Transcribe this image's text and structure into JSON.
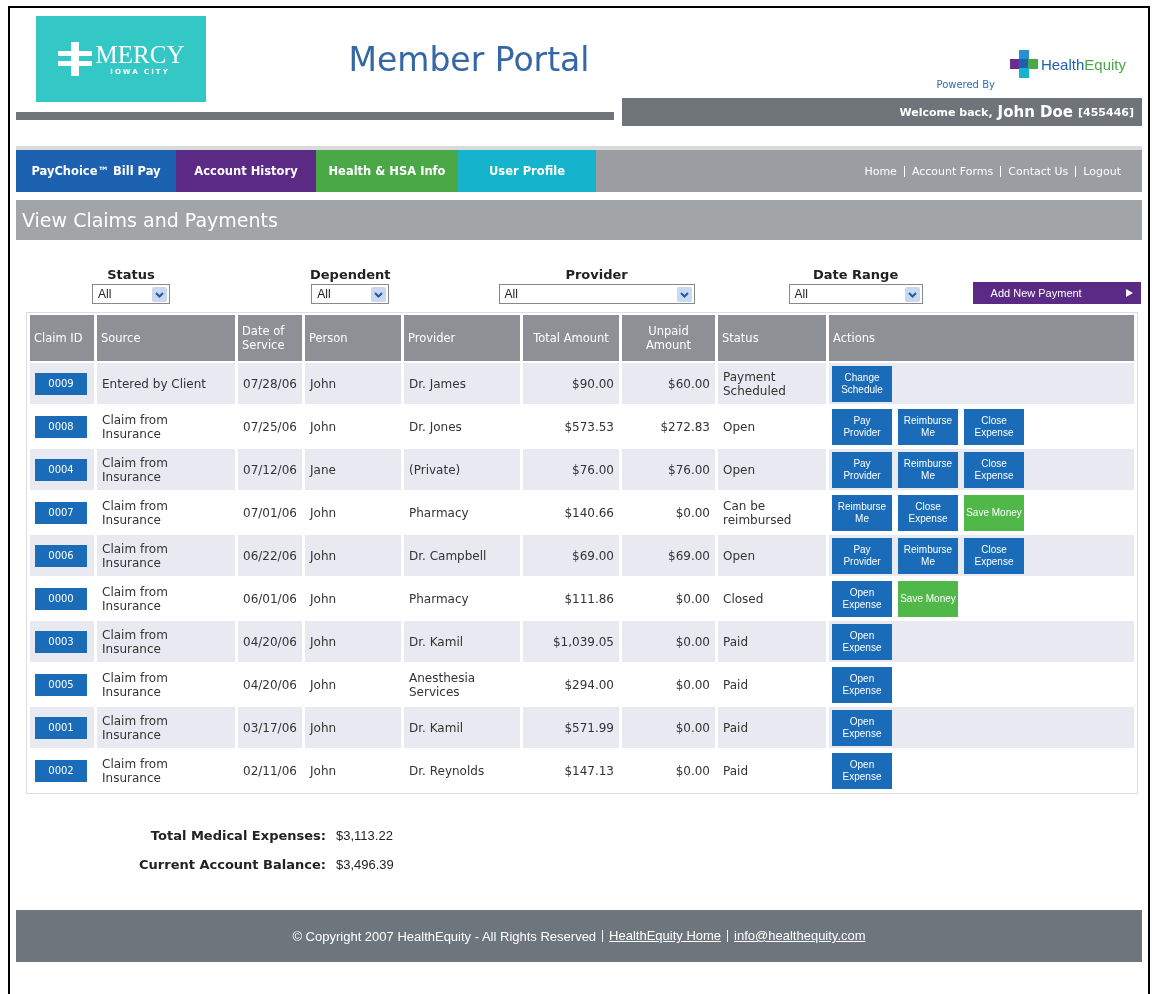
{
  "header": {
    "logo": {
      "name": "MERCY",
      "city": "IOWA CITY"
    },
    "title": "Member Portal",
    "powered_by": "Powered By",
    "partner": {
      "part_a": "Health",
      "part_b": "Equity"
    },
    "welcome": {
      "greeting": "Welcome back,",
      "user": "John Doe",
      "member_id": "[455446]"
    }
  },
  "nav": {
    "tabs": [
      {
        "label": "PayChoice™ Bill Pay",
        "color": "#1c62b0"
      },
      {
        "label": "Account History",
        "color": "#5a2a85"
      },
      {
        "label": "Health & HSA Info",
        "color": "#4aa847"
      },
      {
        "label": "User Profile",
        "color": "#16b4cc"
      }
    ],
    "links": [
      "Home",
      "Account Forms",
      "Contact Us",
      "Logout"
    ]
  },
  "section_title": "View Claims and Payments",
  "filters": [
    {
      "label": "Status",
      "value": "All"
    },
    {
      "label": "Dependent",
      "value": "All"
    },
    {
      "label": "Provider",
      "value": "All"
    },
    {
      "label": "Date Range",
      "value": "All"
    }
  ],
  "add_button": "Add New Payment",
  "table": {
    "columns": [
      "Claim ID",
      "Source",
      "Date of Service",
      "Person",
      "Provider",
      "Total Amount",
      "Unpaid Amount",
      "Status",
      "Actions"
    ],
    "rows": [
      {
        "claim_id": "0009",
        "source": "Entered by Client",
        "date": "07/28/06",
        "person": "John",
        "provider": "Dr. James",
        "total": "$90.00",
        "unpaid": "$60.00",
        "status": "Payment Scheduled",
        "actions": [
          {
            "label": "Change Schedule",
            "kind": "primary"
          }
        ]
      },
      {
        "claim_id": "0008",
        "source": "Claim from Insurance",
        "date": "07/25/06",
        "person": "John",
        "provider": "Dr. Jones",
        "total": "$573.53",
        "unpaid": "$272.83",
        "status": "Open",
        "actions": [
          {
            "label": "Pay Provider",
            "kind": "primary"
          },
          {
            "label": "Reimburse Me",
            "kind": "primary"
          },
          {
            "label": "Close Expense",
            "kind": "primary"
          }
        ]
      },
      {
        "claim_id": "0004",
        "source": "Claim from Insurance",
        "date": "07/12/06",
        "person": "Jane",
        "provider": "(Private)",
        "total": "$76.00",
        "unpaid": "$76.00",
        "status": "Open",
        "actions": [
          {
            "label": "Pay Provider",
            "kind": "primary"
          },
          {
            "label": "Reimburse Me",
            "kind": "primary"
          },
          {
            "label": "Close Expense",
            "kind": "primary"
          }
        ]
      },
      {
        "claim_id": "0007",
        "source": "Claim from Insurance",
        "date": "07/01/06",
        "person": "John",
        "provider": "Pharmacy",
        "total": "$140.66",
        "unpaid": "$0.00",
        "status": "Can be reimbursed",
        "actions": [
          {
            "label": "Reimburse Me",
            "kind": "primary"
          },
          {
            "label": "Close Expense",
            "kind": "primary"
          },
          {
            "label": "Save Money",
            "kind": "save"
          }
        ]
      },
      {
        "claim_id": "0006",
        "source": "Claim from Insurance",
        "date": "06/22/06",
        "person": "John",
        "provider": "Dr. Campbell",
        "total": "$69.00",
        "unpaid": "$69.00",
        "status": "Open",
        "actions": [
          {
            "label": "Pay Provider",
            "kind": "primary"
          },
          {
            "label": "Reimburse Me",
            "kind": "primary"
          },
          {
            "label": "Close Expense",
            "kind": "primary"
          }
        ]
      },
      {
        "claim_id": "0000",
        "source": "Claim from Insurance",
        "date": "06/01/06",
        "person": "John",
        "provider": "Pharmacy",
        "total": "$111.86",
        "unpaid": "$0.00",
        "status": "Closed",
        "actions": [
          {
            "label": "Open Expense",
            "kind": "primary"
          },
          {
            "label": "Save Money",
            "kind": "save"
          }
        ]
      },
      {
        "claim_id": "0003",
        "source": "Claim from Insurance",
        "date": "04/20/06",
        "person": "John",
        "provider": "Dr. Kamil",
        "total": "$1,039.05",
        "unpaid": "$0.00",
        "status": "Paid",
        "actions": [
          {
            "label": "Open Expense",
            "kind": "primary"
          }
        ]
      },
      {
        "claim_id": "0005",
        "source": "Claim from Insurance",
        "date": "04/20/06",
        "person": "John",
        "provider": "Anesthesia Services",
        "total": "$294.00",
        "unpaid": "$0.00",
        "status": "Paid",
        "actions": [
          {
            "label": "Open Expense",
            "kind": "primary"
          }
        ]
      },
      {
        "claim_id": "0001",
        "source": "Claim from Insurance",
        "date": "03/17/06",
        "person": "John",
        "provider": "Dr. Kamil",
        "total": "$571.99",
        "unpaid": "$0.00",
        "status": "Paid",
        "actions": [
          {
            "label": "Open Expense",
            "kind": "primary"
          }
        ]
      },
      {
        "claim_id": "0002",
        "source": "Claim from Insurance",
        "date": "02/11/06",
        "person": "John",
        "provider": "Dr. Reynolds",
        "total": "$147.13",
        "unpaid": "$0.00",
        "status": "Paid",
        "actions": [
          {
            "label": "Open Expense",
            "kind": "primary"
          }
        ]
      }
    ]
  },
  "totals": [
    {
      "label": "Total Medical Expenses:",
      "value": "$3,113.22"
    },
    {
      "label": "Current Account Balance:",
      "value": "$3,496.39"
    }
  ],
  "footer": {
    "copyright": "© Copyright 2007 HealthEquity - All Rights Reserved",
    "links": [
      "HealthEquity Home",
      "info@healthequity.com"
    ]
  }
}
